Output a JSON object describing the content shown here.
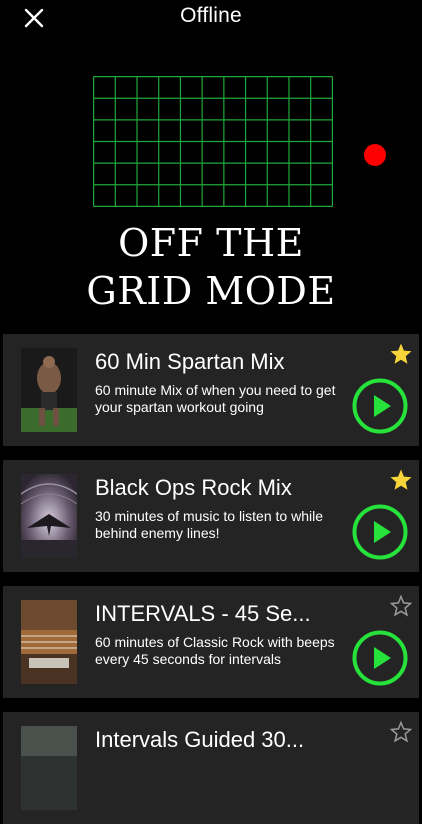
{
  "topbar": {
    "title": "Offline",
    "close_icon": "close-icon"
  },
  "hero": {
    "title_line1": "OFF THE",
    "title_line2": "GRID MODE",
    "grid_color": "#1fa83a",
    "dot_color": "#ff0000"
  },
  "colors": {
    "card_bg": "#242424",
    "play_green": "#27e23a",
    "star_gold": "#f7d43a",
    "star_outline": "#9a9a9a"
  },
  "playlists": [
    {
      "title": "60 Min Spartan Mix",
      "description": "60 minute Mix of when you need to get your spartan workout going",
      "favorite": true,
      "icon": "play-icon"
    },
    {
      "title": "Black Ops Rock Mix",
      "description": "30 minutes of music to listen to while behind enemy lines!",
      "favorite": true,
      "icon": "play-icon"
    },
    {
      "title": "INTERVALS - 45 Se...",
      "description": "60 minutes of Classic Rock with beeps every 45 seconds for intervals",
      "favorite": false,
      "icon": "play-icon"
    },
    {
      "title": "Intervals Guided 30...",
      "description": "",
      "favorite": false,
      "icon": "play-icon"
    }
  ]
}
